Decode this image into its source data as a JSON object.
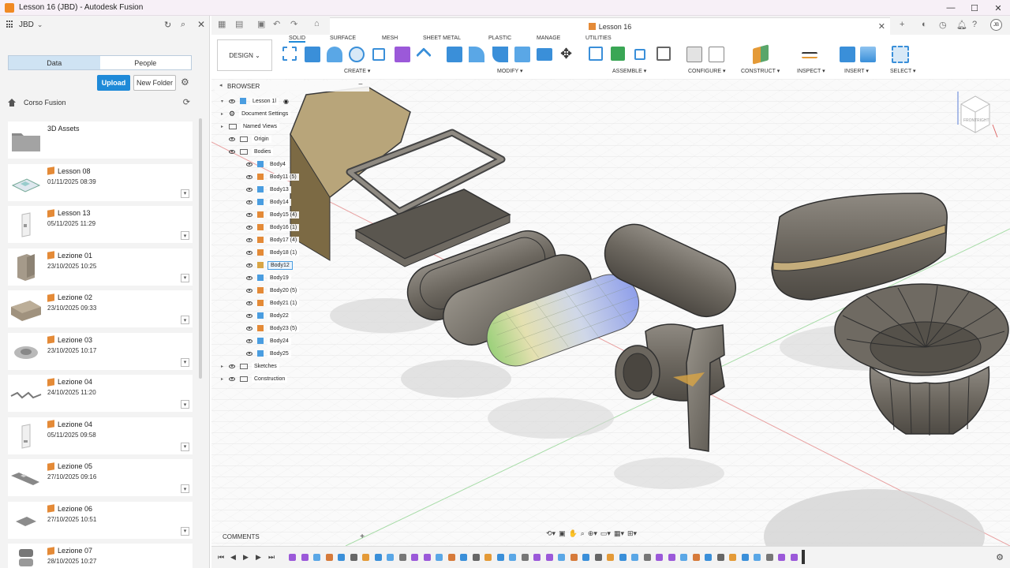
{
  "window": {
    "title": "Lesson 16 (JBD) - Autodesk Fusion",
    "controls": [
      "—",
      "☐",
      "✕"
    ]
  },
  "data_panel": {
    "team": "JBD",
    "tabs": [
      {
        "label": "Data",
        "active": true
      },
      {
        "label": "People",
        "active": false
      }
    ],
    "upload_label": "Upload",
    "new_folder_label": "New Folder",
    "breadcrumb": "Corso Fusion",
    "items": [
      {
        "name": "3D Assets",
        "date": "",
        "kind": "folder"
      },
      {
        "name": "Lesson 08",
        "date": "01/11/2025 08:39",
        "kind": "design"
      },
      {
        "name": "Lesson 13",
        "date": "05/11/2025 11:29",
        "kind": "design"
      },
      {
        "name": "Lezione 01",
        "date": "23/10/2025 10:25",
        "kind": "design"
      },
      {
        "name": "Lezione 02",
        "date": "23/10/2025 09:33",
        "kind": "design"
      },
      {
        "name": "Lezione 03",
        "date": "23/10/2025 10:17",
        "kind": "design"
      },
      {
        "name": "Lezione 04",
        "date": "24/10/2025 11:20",
        "kind": "design"
      },
      {
        "name": "Lezione 04",
        "date": "05/11/2025 09:58",
        "kind": "design"
      },
      {
        "name": "Lezione 05",
        "date": "27/10/2025 09:16",
        "kind": "design"
      },
      {
        "name": "Lezione 06",
        "date": "27/10/2025 10:51",
        "kind": "design"
      },
      {
        "name": "Lezione 07",
        "date": "28/10/2025 10:27",
        "kind": "design"
      }
    ]
  },
  "document_tab": {
    "label": "Lesson 16"
  },
  "user_initials": "JB",
  "ribbon": {
    "workspace": "DESIGN",
    "tabs": [
      "SOLID",
      "SURFACE",
      "MESH",
      "SHEET METAL",
      "PLASTIC",
      "MANAGE",
      "UTILITIES"
    ],
    "active_tab": "SOLID",
    "groups": [
      "CREATE",
      "MODIFY",
      "ASSEMBLE",
      "CONFIGURE",
      "CONSTRUCT",
      "INSPECT",
      "INSERT",
      "SELECT"
    ]
  },
  "browser": {
    "title": "BROWSER",
    "root": "Lesson 1l",
    "nodes": [
      {
        "label": "Document Settings",
        "type": "settings"
      },
      {
        "label": "Named Views",
        "type": "folder"
      },
      {
        "label": "Origin",
        "type": "folder"
      },
      {
        "label": "Bodies",
        "type": "folder"
      },
      {
        "label": "Body4",
        "type": "body-blue"
      },
      {
        "label": "Body11 (5)",
        "type": "body-orange"
      },
      {
        "label": "Body13",
        "type": "body-blue"
      },
      {
        "label": "Body14",
        "type": "body-blue"
      },
      {
        "label": "Body15 (4)",
        "type": "body-orange"
      },
      {
        "label": "Body16 (1)",
        "type": "body-orange"
      },
      {
        "label": "Body17 (4)",
        "type": "body-orange"
      },
      {
        "label": "Body18 (1)",
        "type": "body-orange"
      },
      {
        "label": "Body12",
        "type": "body-selected"
      },
      {
        "label": "Body19",
        "type": "body-blue"
      },
      {
        "label": "Body20 (5)",
        "type": "body-orange"
      },
      {
        "label": "Body21 (1)",
        "type": "body-orange"
      },
      {
        "label": "Body22",
        "type": "body-blue"
      },
      {
        "label": "Body23 (5)",
        "type": "body-orange"
      },
      {
        "label": "Body24",
        "type": "body-blue"
      },
      {
        "label": "Body25",
        "type": "body-blue"
      },
      {
        "label": "Sketches",
        "type": "folder"
      },
      {
        "label": "Construction",
        "type": "folder"
      }
    ]
  },
  "viewcube": {
    "front": "FRONT",
    "right": "RIGHT"
  },
  "comments_label": "COMMENTS",
  "colors": {
    "accent": "#1f8ad8",
    "body_orange": "#e48a37",
    "body_blue": "#4a9de0"
  }
}
